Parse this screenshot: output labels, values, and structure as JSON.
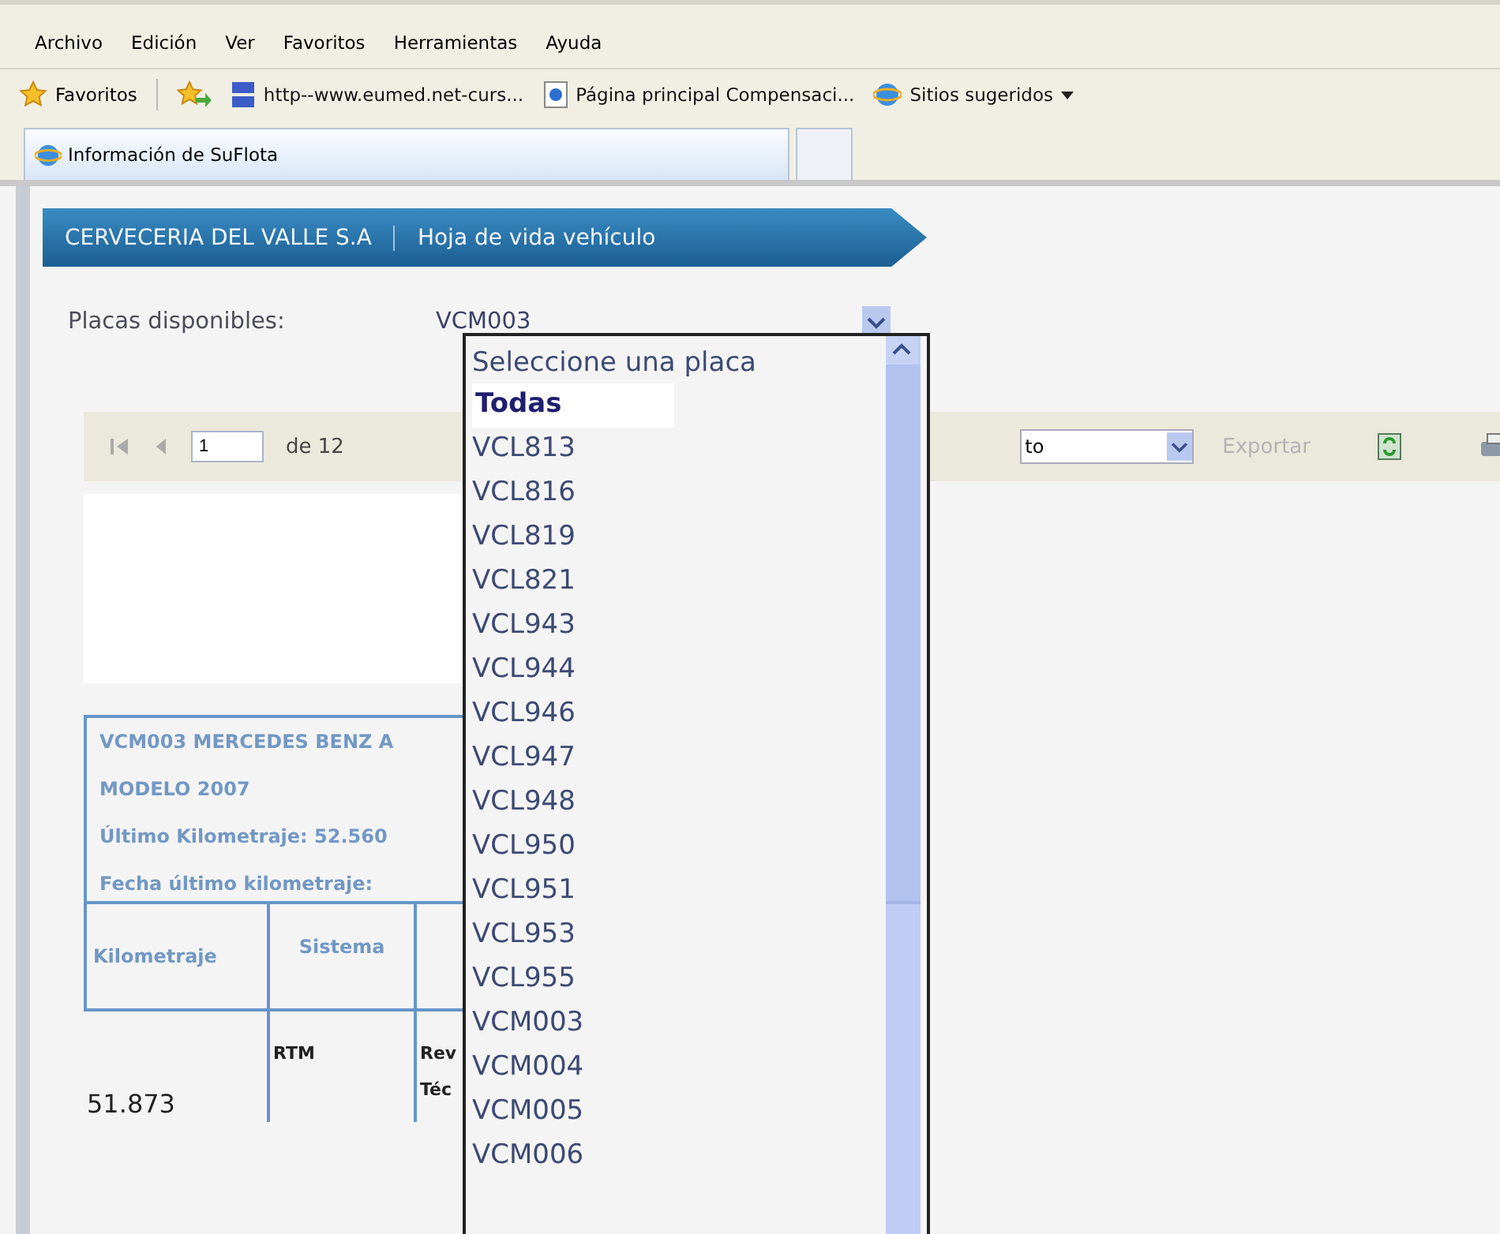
{
  "menu": [
    "Archivo",
    "Edición",
    "Ver",
    "Favoritos",
    "Herramientas",
    "Ayuda"
  ],
  "favorites_bar": {
    "label": "Favoritos",
    "links": [
      {
        "label": "http--www.eumed.net-curs...",
        "kind": "eumed"
      },
      {
        "label": "Página principal Compensaci...",
        "kind": "page"
      },
      {
        "label": "Sitios sugeridos",
        "kind": "ie"
      }
    ]
  },
  "tabs": [
    {
      "label": "Información de SuFlota",
      "selected": true
    },
    {
      "selected": false
    }
  ],
  "breadcrumb": [
    "CERVECERIA DEL VALLE S.A",
    "Hoja de vida vehículo"
  ],
  "plate_selector": {
    "label": "Placas disponibles:",
    "value": "VCM003",
    "options": [
      {
        "label": "Seleccione una placa",
        "highlighted": false
      },
      {
        "label": "Todas",
        "highlighted": true
      },
      {
        "label": "VCL813",
        "highlighted": false
      },
      {
        "label": "VCL816",
        "highlighted": false
      },
      {
        "label": "VCL819",
        "highlighted": false
      },
      {
        "label": "VCL821",
        "highlighted": false
      },
      {
        "label": "VCL943",
        "highlighted": false
      },
      {
        "label": "VCL944",
        "highlighted": false
      },
      {
        "label": "VCL946",
        "highlighted": false
      },
      {
        "label": "VCL947",
        "highlighted": false
      },
      {
        "label": "VCL948",
        "highlighted": false
      },
      {
        "label": "VCL950",
        "highlighted": false
      },
      {
        "label": "VCL951",
        "highlighted": false
      },
      {
        "label": "VCL953",
        "highlighted": false
      },
      {
        "label": "VCL955",
        "highlighted": false
      },
      {
        "label": "VCM003",
        "highlighted": false
      },
      {
        "label": "VCM004",
        "highlighted": false
      },
      {
        "label": "VCM005",
        "highlighted": false
      },
      {
        "label": "VCM006",
        "highlighted": false
      }
    ]
  },
  "report_toolbar": {
    "page": "1",
    "page_count": "de 12",
    "format": "to",
    "export": "Exportar"
  },
  "vehicle_info": [
    "VCM003 MERCEDES BENZ A",
    "MODELO 2007",
    "Último Kilometraje: 52.560",
    "Fecha último kilometraje: "
  ],
  "table": {
    "columns": [
      "Kilometraje",
      "Sistema"
    ],
    "rows": [
      {
        "cells": [
          "51.873",
          "RTM",
          "Rev"
        ],
        "extra": "Téc"
      }
    ]
  }
}
